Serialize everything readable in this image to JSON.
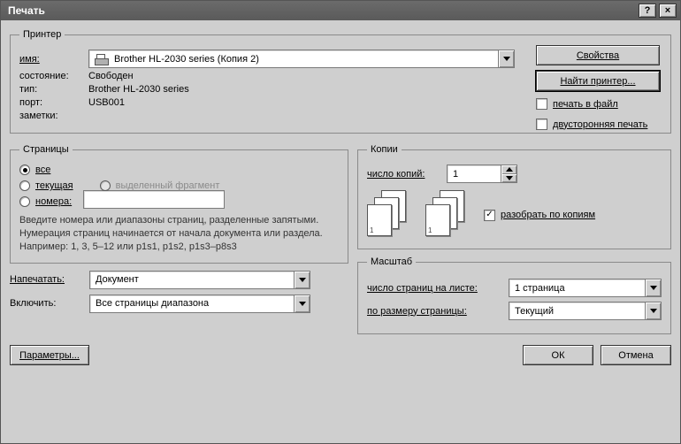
{
  "title": "Печать",
  "printer_group": {
    "legend": "Принтер",
    "name_label": "имя:",
    "name_value": "Brother HL-2030 series (Копия 2)",
    "state_label": "состояние:",
    "state_value": "Свободен",
    "type_label": "тип:",
    "type_value": "Brother HL-2030 series",
    "port_label": "порт:",
    "port_value": "USB001",
    "notes_label": "заметки:",
    "properties_btn": "Свойства",
    "find_printer_btn": "Найти принтер...",
    "print_to_file": "печать в файл",
    "duplex": "двусторонняя печать"
  },
  "pages_group": {
    "legend": "Страницы",
    "all": "все",
    "current": "текущая",
    "selection": "выделенный фрагмент",
    "numbers": "номера:",
    "hint": "Введите номера или диапазоны страниц, разделенные запятыми. Нумерация страниц начинается от начала документа или раздела. Например: 1, 3, 5–12 или p1s1, p1s2, p1s3–p8s3"
  },
  "copies_group": {
    "legend": "Копии",
    "count_label": "число копий:",
    "count_value": "1",
    "collate": "разобрать по копиям",
    "collate_checked": true
  },
  "print_what_label": "Напечатать:",
  "print_what_value": "Документ",
  "include_label": "Включить:",
  "include_value": "Все страницы диапазона",
  "scale_group": {
    "legend": "Масштаб",
    "pages_per_sheet_label": "число страниц на листе:",
    "pages_per_sheet_value": "1 страница",
    "fit_label": "по размеру страницы:",
    "fit_value": "Текущий"
  },
  "footer": {
    "options": "Параметры...",
    "ok": "ОК",
    "cancel": "Отмена"
  }
}
